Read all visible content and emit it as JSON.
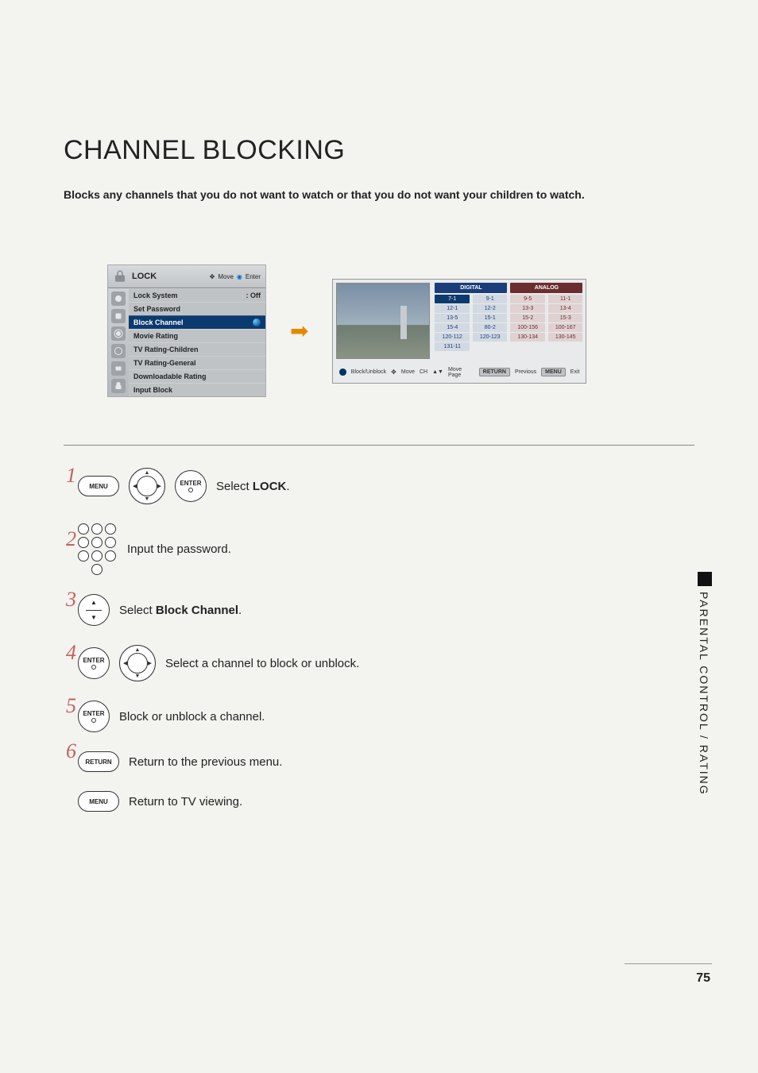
{
  "page": {
    "title": "CHANNEL BLOCKING",
    "intro": "Blocks any channels that you do not want to watch or that you do not want your children to watch.",
    "section_side": "PARENTAL CONTROL / RATING",
    "page_number": "75"
  },
  "osd": {
    "title": "LOCK",
    "hint_move": "Move",
    "hint_enter": "Enter",
    "items": [
      {
        "label": "Lock System",
        "value": ": Off"
      },
      {
        "label": "Set Password",
        "value": ""
      },
      {
        "label": "Block Channel",
        "value": "",
        "selected": true
      },
      {
        "label": "Movie Rating",
        "value": ""
      },
      {
        "label": "TV Rating-Children",
        "value": ""
      },
      {
        "label": "TV Rating-General",
        "value": ""
      },
      {
        "label": "Downloadable Rating",
        "value": ""
      },
      {
        "label": "Input Block",
        "value": ""
      }
    ]
  },
  "channel_screen": {
    "current": "7-1",
    "tab_digital": "DIGITAL",
    "tab_analog": "ANALOG",
    "columns": [
      {
        "type": "digital",
        "cells": [
          "7-1",
          "12-1",
          "13-5",
          "15-4",
          "120-112",
          "131-11"
        ],
        "selectedIndex": 0
      },
      {
        "type": "digital",
        "cells": [
          "9-1",
          "12-2",
          "15-1",
          "80-2",
          "120-123"
        ]
      },
      {
        "type": "analog",
        "cells": [
          "9-5",
          "13-3",
          "15-2",
          "100-156",
          "130-134"
        ]
      },
      {
        "type": "analog",
        "cells": [
          "11-1",
          "13-4",
          "15-3",
          "100-167",
          "130-145"
        ]
      }
    ],
    "footer": {
      "block_unblock": "Block/Unblock",
      "move": "Move",
      "ch": "CH",
      "move_page": "Move Page",
      "return_key": "RETURN",
      "previous": "Previous",
      "menu_key": "MENU",
      "exit": "Exit"
    }
  },
  "buttons": {
    "menu": "MENU",
    "enter": "ENTER",
    "return": "RETURN"
  },
  "steps": {
    "s1": {
      "pre": "Select ",
      "bold": "LOCK",
      "post": "."
    },
    "s2": {
      "text": "Input the password."
    },
    "s3": {
      "pre": "Select ",
      "bold": "Block Channel",
      "post": "."
    },
    "s4": {
      "text": "Select a channel to block or unblock."
    },
    "s5": {
      "text": "Block or unblock a channel."
    },
    "s6": {
      "text": "Return to the previous menu."
    },
    "s7": {
      "text": "Return to TV viewing."
    }
  }
}
